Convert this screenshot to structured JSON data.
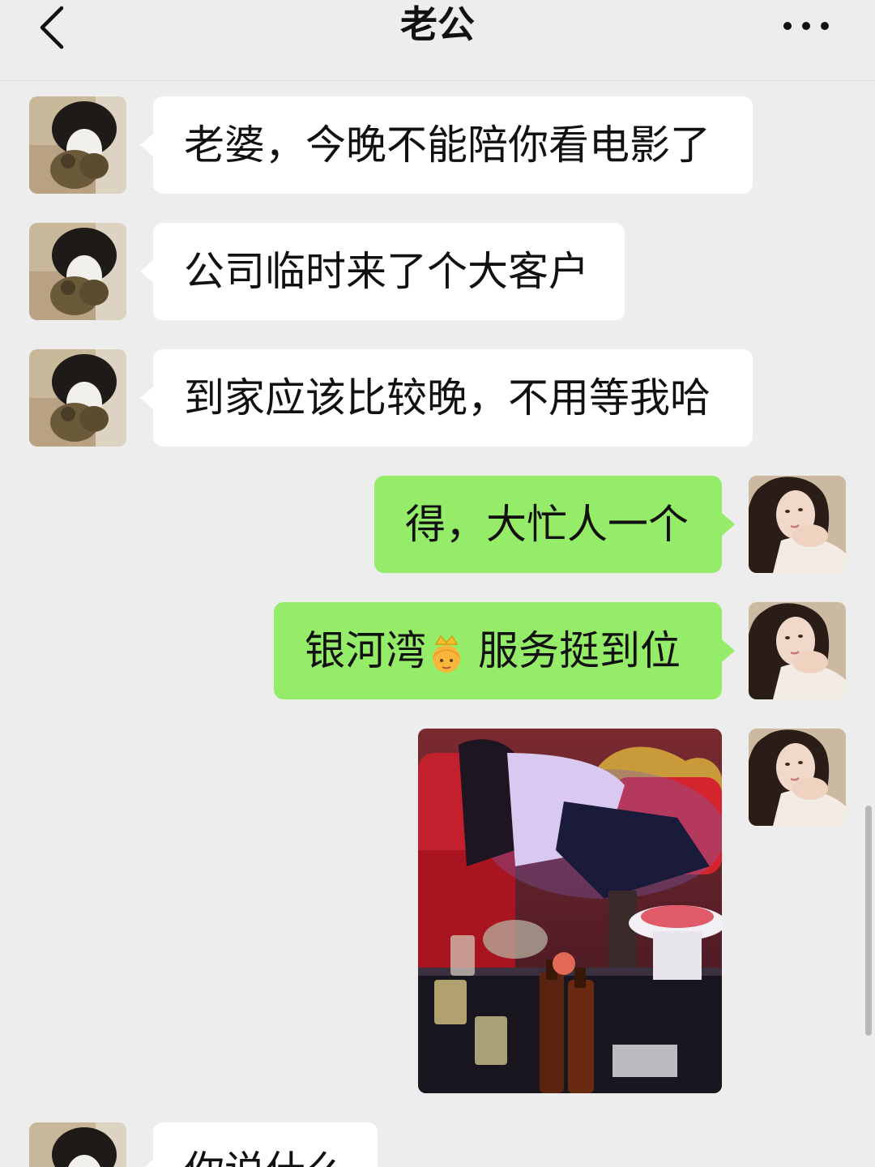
{
  "header": {
    "title": "老公",
    "back_icon": "chevron-left-icon",
    "more_icon": "more-dots-icon"
  },
  "messages": [
    {
      "side": "in",
      "text": "老婆，今晚不能陪你看电影了"
    },
    {
      "side": "in",
      "text": "公司临时来了个大客户"
    },
    {
      "side": "in",
      "text": "到家应该比较晚，不用等我哈"
    },
    {
      "side": "out",
      "text": "得，大忙人一个"
    },
    {
      "side": "out",
      "text_before": "银河湾",
      "emoji": "princess-emoji-icon",
      "text_after": "服务挺到位"
    },
    {
      "side": "out",
      "type": "image",
      "description_icon": "photo-image"
    },
    {
      "side": "in",
      "text": "你说什么"
    }
  ],
  "colors": {
    "background": "#ededed",
    "incoming_bubble": "#ffffff",
    "outgoing_bubble": "#95ec69",
    "text": "#111111"
  }
}
